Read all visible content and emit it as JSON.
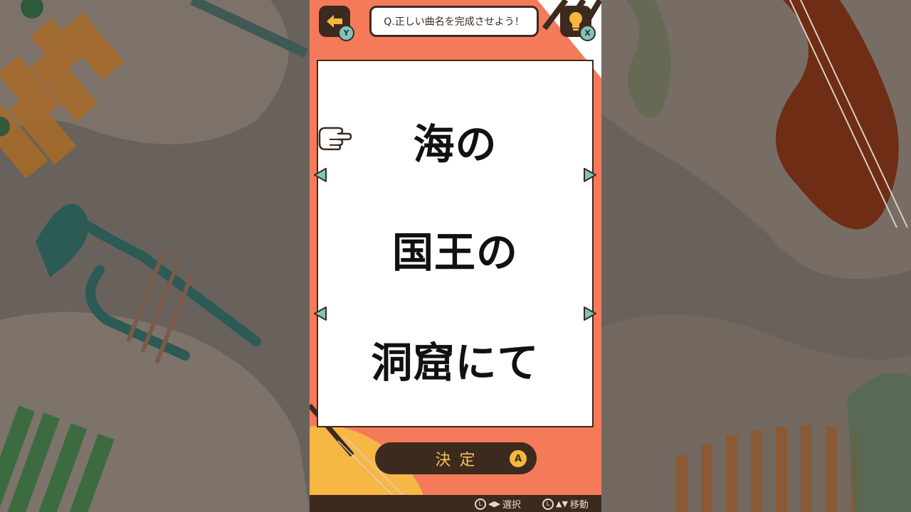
{
  "question": "Q.正しい曲名を完成させよう！",
  "title_lines": [
    "海の",
    "国王の",
    "洞窟にて"
  ],
  "confirm_label": "決定",
  "keys": {
    "back": "Y",
    "hint": "X",
    "confirm": "A",
    "stick": "L"
  },
  "footer": {
    "select_arrows": "◀▶",
    "select_label": "選択",
    "move_arrows": "▲▼",
    "move_label": "移動"
  },
  "icons": {
    "back": "left-arrow-icon",
    "hint": "lightbulb-icon",
    "pointer": "pointing-hand-icon",
    "arrows": "triangle-arrow-icon"
  },
  "colors": {
    "accent": "#f47a5a",
    "dark": "#3d2a1e",
    "teal": "#7cc5c0",
    "gold": "#f6b73c"
  }
}
